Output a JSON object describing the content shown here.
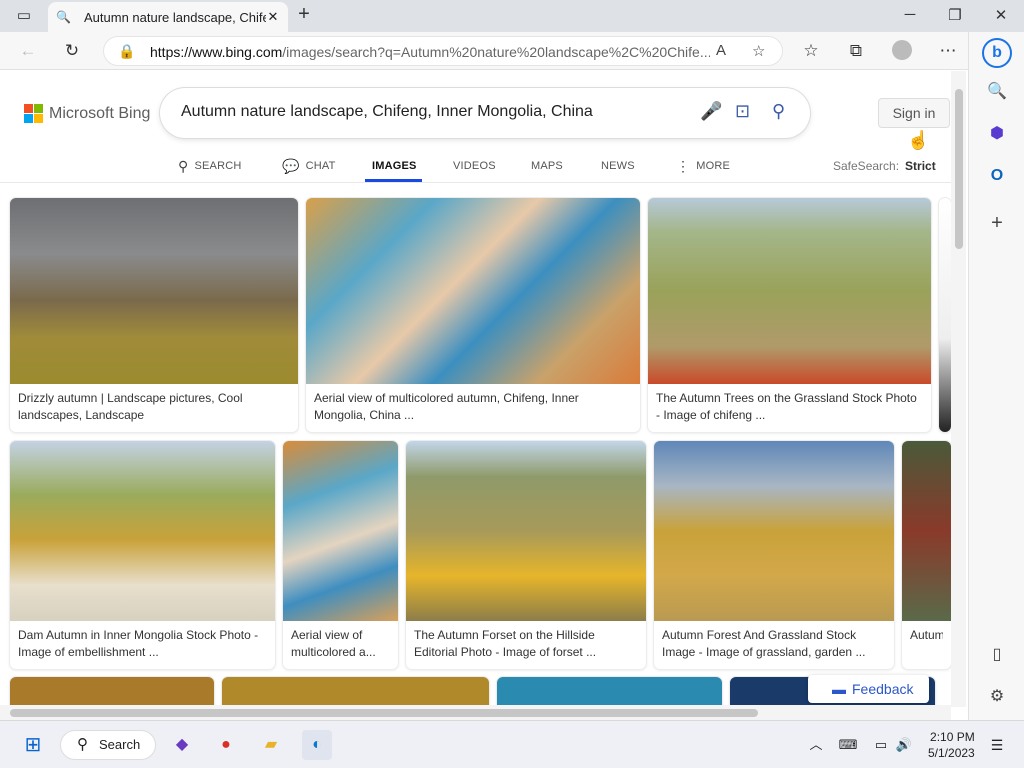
{
  "browser": {
    "tab_title": "Autumn nature landscape, Chifer",
    "url_domain": "https://www.bing.com",
    "url_rest": "/images/search?q=Autumn%20nature%20landscape%2C%20Chife..."
  },
  "bing": {
    "logo_text": "Microsoft Bing",
    "query": "Autumn nature landscape, Chifeng, Inner Mongolia, China",
    "sign_in": "Sign in",
    "scopes": [
      "SEARCH",
      "CHAT",
      "IMAGES",
      "VIDEOS",
      "MAPS",
      "NEWS",
      "MORE"
    ],
    "safesearch_label": "SafeSearch:",
    "safesearch_value": "Strict",
    "feedback": "Feedback"
  },
  "results": {
    "row1": [
      "Drizzly autumn | Landscape pictures, Cool landscapes, Landscape",
      "Aerial view of multicolored autumn, Chifeng, Inner Mongolia, China ...",
      "The Autumn Trees on the Grassland Stock Photo - Image of chifeng ..."
    ],
    "row2": [
      "Dam Autumn in Inner Mongolia Stock Photo - Image of embellishment ...",
      "Aerial view of multicolored a...",
      "The Autumn Forset on the Hillside Editorial Photo - Image of forset ...",
      "Autumn Forest And Grassland Stock Image - Image of grassland, garden ...",
      "Autumn reserve..."
    ]
  },
  "taskbar": {
    "search": "Search",
    "time": "2:10 PM",
    "date": "5/1/2023"
  }
}
